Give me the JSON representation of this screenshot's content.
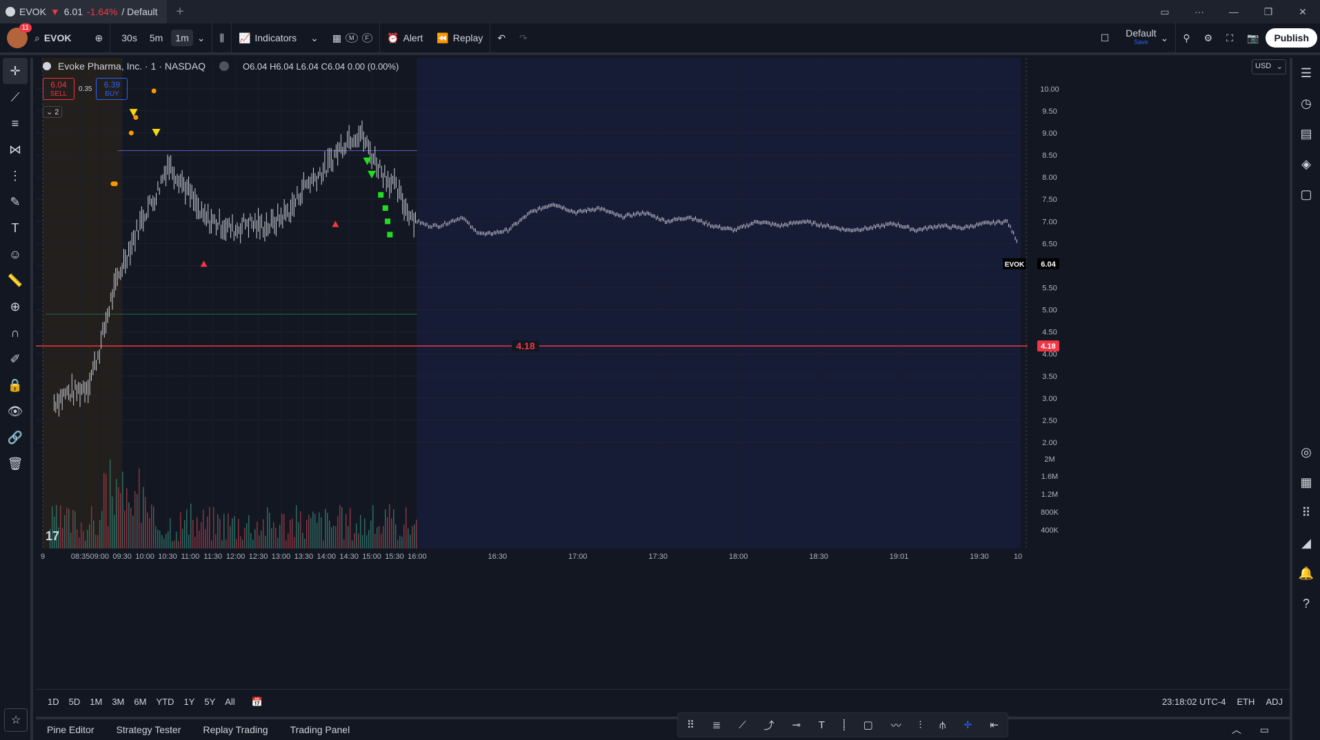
{
  "tab": {
    "symbol": "EVOK",
    "arrow": "▼",
    "price": "6.01",
    "change": "-1.64%",
    "layout": "/ Default"
  },
  "toolbar": {
    "notifications": "11",
    "symbol": "EVOK",
    "timeframes": [
      "30s",
      "5m",
      "1m"
    ],
    "indicators": "Indicators",
    "alert": "Alert",
    "replay": "Replay",
    "layout_name": "Default",
    "layout_save": "Save",
    "publish": "Publish",
    "badge_m": "M",
    "badge_f": "F"
  },
  "legend": {
    "title": "Evoke Pharma, Inc. · 1 · NASDAQ",
    "o_label": "O",
    "o": "6.04",
    "h_label": "H",
    "h": "6.04",
    "l_label": "L",
    "l": "6.04",
    "c_label": "C",
    "c": "6.04",
    "chg": "0.00 (0.00%)"
  },
  "trade": {
    "sell_price": "6.04",
    "sell_label": "SELL",
    "spread": "0.35",
    "buy_price": "6.39",
    "buy_label": "BUY",
    "collapse_count": "2"
  },
  "currency": "USD",
  "colors": {
    "accent": "#2962ff",
    "down": "#f23645",
    "up": "#22ab94",
    "bg": "#131722"
  },
  "chart_data": {
    "type": "bar",
    "title": "Evoke Pharma, Inc. · 1 · NASDAQ",
    "price_axis": [
      "10.00",
      "9.50",
      "9.00",
      "8.50",
      "8.00",
      "7.50",
      "7.00",
      "6.50",
      "6.00",
      "5.50",
      "5.00",
      "4.50",
      "4.00",
      "3.50",
      "3.00",
      "2.50",
      "2.00"
    ],
    "volume_axis": [
      "2M",
      "1.6M",
      "1.2M",
      "800K",
      "400K"
    ],
    "time_axis": [
      "9",
      "08:35",
      "09:00",
      "09:30",
      "10:00",
      "10:30",
      "11:00",
      "11:30",
      "12:00",
      "12:30",
      "13:00",
      "13:30",
      "14:00",
      "14:30",
      "15:00",
      "15:30",
      "16:00",
      "16:30",
      "17:00",
      "17:30",
      "18:00",
      "18:30",
      "19:01",
      "19:30",
      "10"
    ],
    "ylim": [
      2.0,
      10.2
    ],
    "horizontal_line": {
      "value": 4.18,
      "label": "4.18"
    },
    "last_price": {
      "symbol": "EVOK",
      "value": "6.04"
    },
    "series": [
      {
        "values": [
          [
            8.0,
            2.9
          ],
          [
            8.25,
            3.1
          ],
          [
            8.5,
            3.15
          ],
          [
            8.75,
            3.3
          ],
          [
            9.0,
            4.1
          ],
          [
            9.25,
            5.2
          ],
          [
            9.5,
            6.0
          ],
          [
            9.75,
            6.6
          ],
          [
            10.0,
            7.2
          ],
          [
            10.25,
            7.6
          ],
          [
            10.5,
            8.3
          ],
          [
            10.75,
            8.0
          ],
          [
            11.0,
            7.6
          ],
          [
            11.25,
            7.1
          ],
          [
            11.5,
            7.0
          ],
          [
            11.75,
            6.9
          ],
          [
            12.0,
            6.8
          ],
          [
            12.25,
            7.0
          ],
          [
            12.5,
            6.9
          ],
          [
            12.75,
            6.9
          ],
          [
            13.0,
            7.1
          ],
          [
            13.25,
            7.3
          ],
          [
            13.5,
            7.8
          ],
          [
            13.75,
            8.0
          ],
          [
            14.0,
            8.2
          ],
          [
            14.25,
            8.6
          ],
          [
            14.5,
            8.9
          ],
          [
            14.75,
            9.0
          ],
          [
            15.0,
            8.5
          ],
          [
            15.25,
            8.1
          ],
          [
            15.5,
            7.8
          ],
          [
            15.75,
            7.3
          ],
          [
            16.0,
            7.0
          ],
          [
            16.25,
            6.9
          ],
          [
            16.5,
            6.9
          ],
          [
            16.75,
            7.0
          ],
          [
            17.0,
            7.1
          ],
          [
            17.25,
            6.8
          ],
          [
            17.5,
            6.7
          ],
          [
            18.0,
            6.8
          ],
          [
            18.5,
            7.2
          ],
          [
            19.0,
            7.4
          ],
          [
            19.5,
            7.2
          ],
          [
            20.0,
            7.3
          ],
          [
            20.5,
            7.1
          ],
          [
            21.0,
            7.2
          ],
          [
            21.5,
            7.0
          ],
          [
            22.0,
            7.1
          ],
          [
            22.5,
            6.9
          ],
          [
            23.0,
            6.8
          ],
          [
            23.5,
            7.0
          ],
          [
            24.0,
            6.9
          ],
          [
            24.5,
            7.0
          ],
          [
            25.0,
            6.9
          ],
          [
            25.5,
            6.8
          ],
          [
            26.0,
            6.85
          ],
          [
            26.5,
            6.95
          ],
          [
            27.0,
            6.8
          ],
          [
            27.5,
            6.9
          ],
          [
            28.0,
            6.85
          ],
          [
            28.5,
            6.95
          ],
          [
            29.0,
            7.0
          ],
          [
            29.25,
            6.5
          ]
        ]
      }
    ]
  },
  "timebar": {
    "ranges": [
      "1D",
      "5D",
      "1M",
      "3M",
      "6M",
      "YTD",
      "1Y",
      "5Y",
      "All"
    ],
    "clock": "23:18:02 UTC-4",
    "session": "ETH",
    "adj": "ADJ"
  },
  "bottom_tabs": [
    "Pine Editor",
    "Strategy Tester",
    "Replay Trading",
    "Trading Panel"
  ]
}
